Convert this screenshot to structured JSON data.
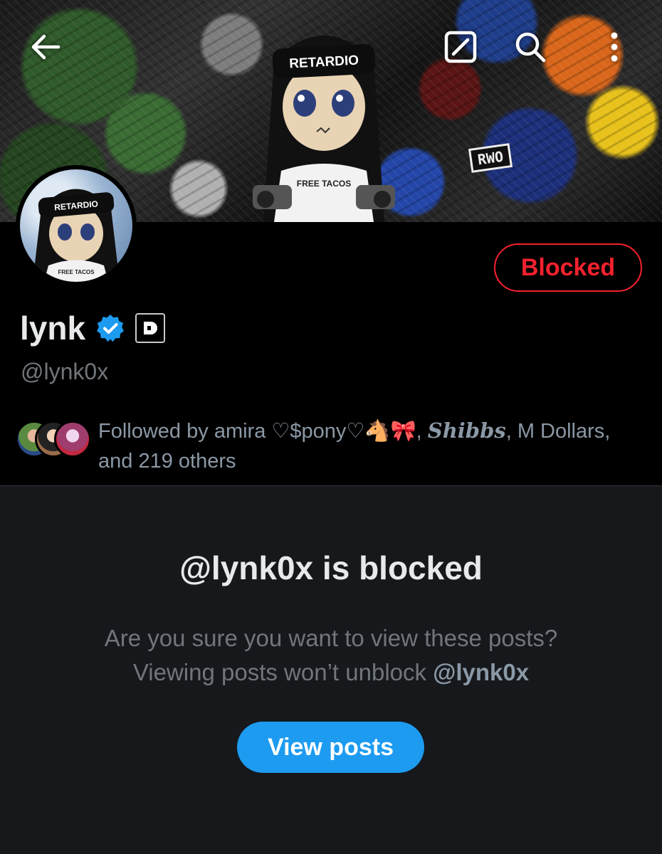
{
  "banner": {
    "headband_text": "RETARDIO",
    "shirt_text": "FREE TACOS",
    "tag_text": "RWO"
  },
  "topbar": {
    "back_icon": "arrow-left-icon",
    "share_icon": "share-icon",
    "search_icon": "search-icon",
    "more_icon": "more-vertical-icon"
  },
  "profile": {
    "display_name": "lynk",
    "handle": "@lynk0x",
    "verified_icon": "verified-badge-icon",
    "affiliate_icon": "affiliate-badge-icon",
    "blocked_button_label": "Blocked",
    "followed_by": {
      "prefix": "Followed by ",
      "name1": "amira ♡$pony♡🐴🎀",
      "sep1": ", ",
      "name2": "Shibbs",
      "sep2": ", ",
      "name3": "M Dollars",
      "suffix": ", and 219 others"
    }
  },
  "blocked_panel": {
    "title": "@lynk0x is blocked",
    "line1": "Are you sure you want to view these posts?",
    "line2_prefix": "Viewing posts won’t unblock ",
    "line2_handle": "@lynk0x",
    "view_button_label": "View posts"
  },
  "colors": {
    "blocked_red": "#f4212e",
    "accent_blue": "#1d9bf0",
    "secondary_text": "#71767b"
  }
}
